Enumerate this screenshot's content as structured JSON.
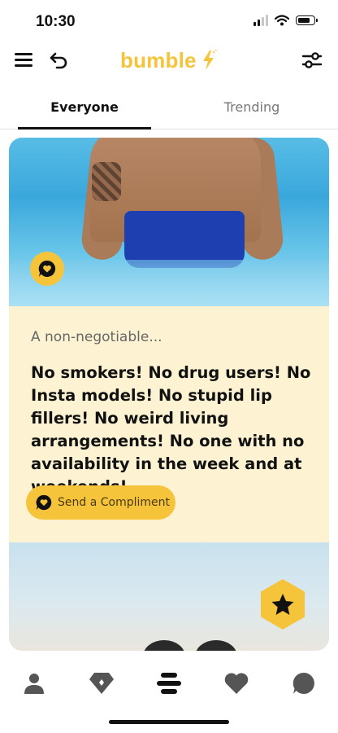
{
  "status_bar": {
    "time": "10:30"
  },
  "header": {
    "logo_text": "bumble",
    "brand_color": "#f6c43a"
  },
  "tabs": [
    {
      "label": "Everyone",
      "active": true
    },
    {
      "label": "Trending",
      "active": false
    }
  ],
  "card": {
    "prompt_question": "A non-negotiable...",
    "prompt_answer": "No smokers! No drug users! No Insta models! No stupid lip fillers! No weird living arrangements! No one with no availability in the week and at weekends!",
    "compliment_button_label": "Send a Compliment"
  },
  "icons": {
    "header": [
      "menu-icon",
      "undo-icon",
      "bolt-icon",
      "filter-icon"
    ],
    "card": [
      "compliment-icon",
      "star-icon"
    ],
    "bottom_nav": [
      "profile-icon",
      "diamond-icon",
      "feed-icon",
      "heart-icon",
      "chat-icon"
    ]
  },
  "colors": {
    "accent": "#f6c43a",
    "card_background": "#fdf3d2",
    "text": "#111111"
  }
}
